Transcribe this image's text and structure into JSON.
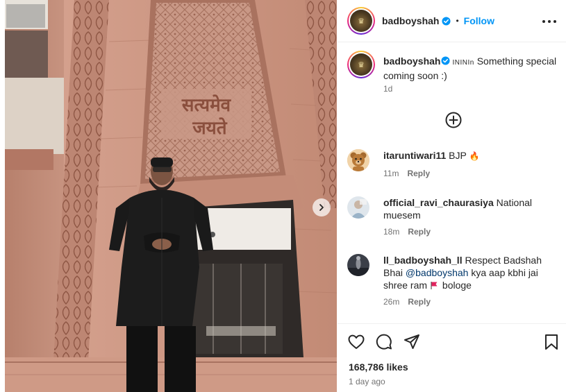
{
  "media": {
    "sign_line1": "सत्यमेव",
    "sign_line2": "जयते",
    "next_icon": "chevron-right-icon"
  },
  "header": {
    "username": "badboyshah",
    "verified_icon": "verified-badge-icon",
    "separator": "•",
    "follow_label": "Follow",
    "more_icon": "more-options-icon"
  },
  "caption": {
    "username": "badboyshah",
    "prefix": "ININIn",
    "text": "Something special coming soon :)",
    "time": "1d"
  },
  "load_more_icon": "plus-circle-icon",
  "comments": [
    {
      "username": "itaruntiwari11",
      "text": "BJP",
      "emoji": "🔥",
      "time": "11m",
      "reply": "Reply"
    },
    {
      "username": "official_ravi_chaurasiya",
      "text": "National muesem",
      "time": "18m",
      "reply": "Reply"
    },
    {
      "username": "ll_badboyshah_ll",
      "text": "Respect Badshah Bhai",
      "mention": "@badboyshah",
      "text2": "kya aap kbhi jai shree ram",
      "flag_icon": "flag-icon",
      "text3": "bologe",
      "time": "26m",
      "reply": "Reply"
    }
  ],
  "actions": {
    "like_icon": "heart-icon",
    "comment_icon": "comment-icon",
    "share_icon": "share-icon",
    "save_icon": "bookmark-icon",
    "likes": "168,786 likes",
    "time_ago": "1 day ago"
  },
  "colors": {
    "link": "#0095f6",
    "verified": "#0095f6",
    "secondary_text": "#737373"
  }
}
